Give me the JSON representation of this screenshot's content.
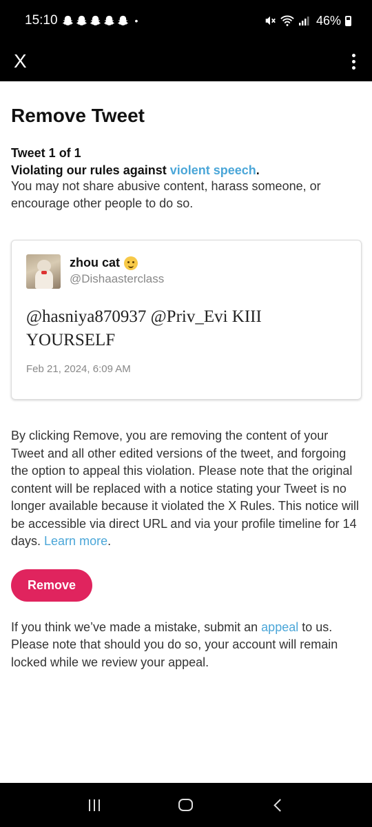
{
  "status_bar": {
    "time": "15:10",
    "notification_icons": [
      "snapchat-ghost-icon",
      "snapchat-ghost-icon",
      "snapchat-ghost-icon",
      "snapchat-ghost-icon",
      "snapchat-ghost-icon"
    ],
    "dot": "•",
    "battery_percent": "46%"
  },
  "app_bar": {
    "close_label": "X"
  },
  "page": {
    "title": "Remove Tweet",
    "tweet_count": "Tweet 1 of 1",
    "violation_prefix": "Violating our rules against ",
    "violation_link": "violent speech",
    "violation_suffix": ".",
    "violation_description": "You may not share abusive content, harass someone, or encourage other people to do so."
  },
  "tweet": {
    "display_name": "zhou cat",
    "handle": "@Dishaasterclass",
    "text": "@hasniya870937 @Priv_Evi KIII YOURSELF",
    "date": "Feb 21, 2024, 6:09 AM"
  },
  "remove_info": {
    "text": "By clicking Remove, you are removing the content of your Tweet and all other edited versions of the tweet, and forgoing the option to appeal this violation. Please note that the original content will be replaced with a notice stating your Tweet is no longer available because it violated the X Rules. This notice will be accessible via direct URL and via your profile timeline for 14 days. ",
    "learn_more": "Learn more",
    "period": "."
  },
  "remove_button_label": "Remove",
  "appeal_info": {
    "prefix": "If you think we’ve made a mistake, submit an ",
    "link": "appeal",
    "suffix": " to us. Please note that should you do so, your account will remain locked while we review your appeal."
  },
  "colors": {
    "link": "#4aa6d8",
    "remove_button": "#e0245e",
    "bars": "#000000"
  }
}
